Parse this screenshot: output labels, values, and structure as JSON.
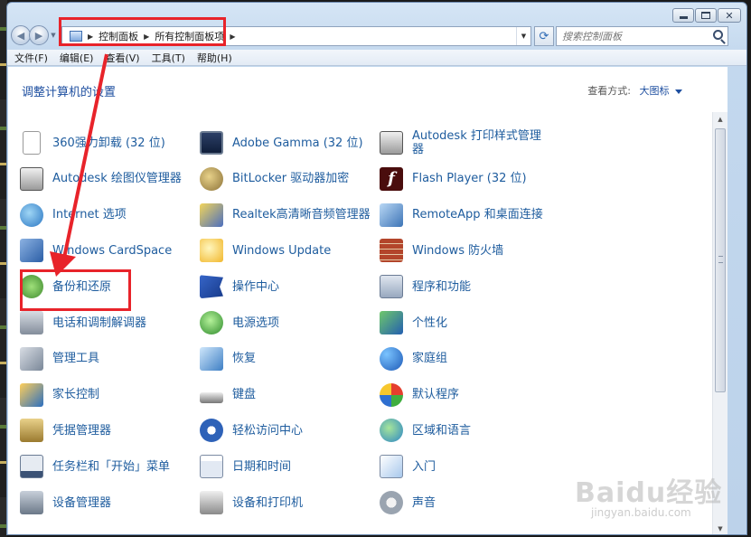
{
  "window": {
    "breadcrumbs": [
      "控制面板",
      "所有控制面板项"
    ],
    "search_placeholder": "搜索控制面板"
  },
  "menu": [
    "文件(F)",
    "编辑(E)",
    "查看(V)",
    "工具(T)",
    "帮助(H)"
  ],
  "header": {
    "title": "调整计算机的设置",
    "view_by_label": "查看方式:",
    "view_by_value": "大图标"
  },
  "items": [
    {
      "label": "360强力卸载 (32 位)",
      "icon": "document-icon"
    },
    {
      "label": "Adobe Gamma (32 位)",
      "icon": "monitor-icon"
    },
    {
      "label": "Autodesk 打印样式管理器",
      "icon": "printer-icon"
    },
    {
      "label": "Autodesk 绘图仪管理器",
      "icon": "plotter-icon"
    },
    {
      "label": "BitLocker 驱动器加密",
      "icon": "keys-icon"
    },
    {
      "label": "Flash Player (32 位)",
      "icon": "flash-icon"
    },
    {
      "label": "Internet 选项",
      "icon": "globe-icon"
    },
    {
      "label": "Realtek高清晰音频管理器",
      "icon": "audio-icon"
    },
    {
      "label": "RemoteApp 和桌面连接",
      "icon": "remote-icon"
    },
    {
      "label": "Windows CardSpace",
      "icon": "cardspace-icon"
    },
    {
      "label": "Windows Update",
      "icon": "update-icon"
    },
    {
      "label": "Windows 防火墙",
      "icon": "firewall-icon"
    },
    {
      "label": "备份和还原",
      "icon": "backup-icon"
    },
    {
      "label": "操作中心",
      "icon": "flag-icon"
    },
    {
      "label": "程序和功能",
      "icon": "programs-icon"
    },
    {
      "label": "电话和调制解调器",
      "icon": "phone-icon"
    },
    {
      "label": "电源选项",
      "icon": "power-icon"
    },
    {
      "label": "个性化",
      "icon": "personalize-icon"
    },
    {
      "label": "管理工具",
      "icon": "tools-icon"
    },
    {
      "label": "恢复",
      "icon": "recovery-icon"
    },
    {
      "label": "家庭组",
      "icon": "homegroup-icon"
    },
    {
      "label": "家长控制",
      "icon": "parental-icon"
    },
    {
      "label": "键盘",
      "icon": "keyboard-icon"
    },
    {
      "label": "默认程序",
      "icon": "default-programs-icon"
    },
    {
      "label": "凭据管理器",
      "icon": "credential-icon"
    },
    {
      "label": "轻松访问中心",
      "icon": "accessibility-icon"
    },
    {
      "label": "区域和语言",
      "icon": "region-icon"
    },
    {
      "label": "任务栏和「开始」菜单",
      "icon": "taskbar-icon"
    },
    {
      "label": "日期和时间",
      "icon": "date-time-icon"
    },
    {
      "label": "入门",
      "icon": "getting-started-icon"
    },
    {
      "label": "设备管理器",
      "icon": "device-manager-icon"
    },
    {
      "label": "设备和打印机",
      "icon": "devices-printers-icon"
    },
    {
      "label": "声音",
      "icon": "sound-icon"
    }
  ],
  "watermark": {
    "main": "Baidu经验",
    "sub": "jingyan.baidu.com"
  },
  "colors": {
    "annotation": "#e8232a",
    "link": "#1e5c9e",
    "title": "#1e4fa0"
  }
}
